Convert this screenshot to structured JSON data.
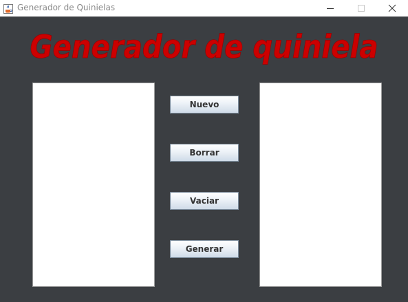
{
  "window": {
    "title": "Generador de Quinielas",
    "icon": "java-cup-icon"
  },
  "colors": {
    "background": "#3b3e42",
    "heading": "#cc0000",
    "panel": "#ffffff"
  },
  "heading": "Generador de quiniela",
  "buttons": {
    "nuevo": "Nuevo",
    "borrar": "Borrar",
    "vaciar": "Vaciar",
    "generar": "Generar"
  }
}
